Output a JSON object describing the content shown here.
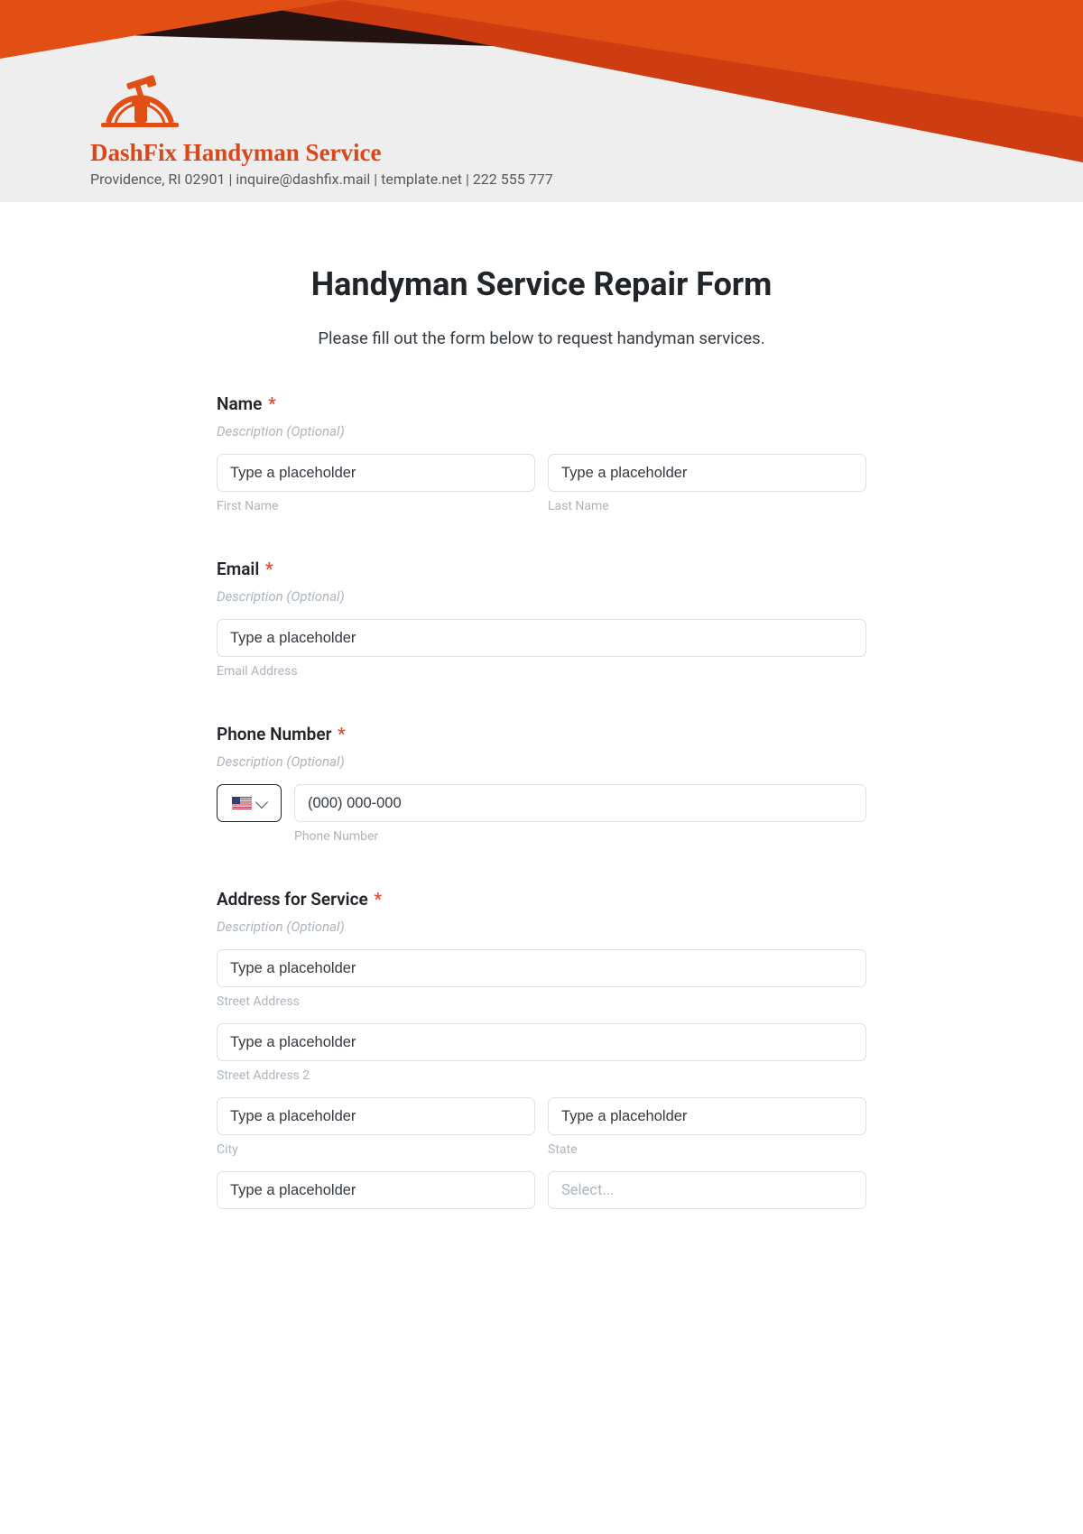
{
  "brand": {
    "name": "DashFix Handyman Service",
    "sub": "Providence, RI 02901 | inquire@dashfix.mail | template.net | 222 555 777"
  },
  "form": {
    "title": "Handyman Service Repair Form",
    "subtitle": "Please fill out the form below to request handyman services."
  },
  "name": {
    "label": "Name",
    "desc": "Description (Optional)",
    "first_ph": "Type a placeholder",
    "first_sub": "First Name",
    "last_ph": "Type a placeholder",
    "last_sub": "Last Name"
  },
  "email": {
    "label": "Email",
    "desc": "Description (Optional)",
    "ph": "Type a placeholder",
    "sub": "Email Address"
  },
  "phone": {
    "label": "Phone Number",
    "desc": "Description (Optional)",
    "ph": "(000) 000-000",
    "sub": "Phone Number"
  },
  "address": {
    "label": "Address for Service",
    "desc": "Description (Optional)",
    "street_ph": "Type a placeholder",
    "street_sub": "Street Address",
    "street2_ph": "Type a placeholder",
    "street2_sub": "Street Address 2",
    "city_ph": "Type a placeholder",
    "city_sub": "City",
    "state_ph": "Type a placeholder",
    "state_sub": "State",
    "zip_ph": "Type a placeholder",
    "country_ph": "Select..."
  },
  "required_mark": "*"
}
